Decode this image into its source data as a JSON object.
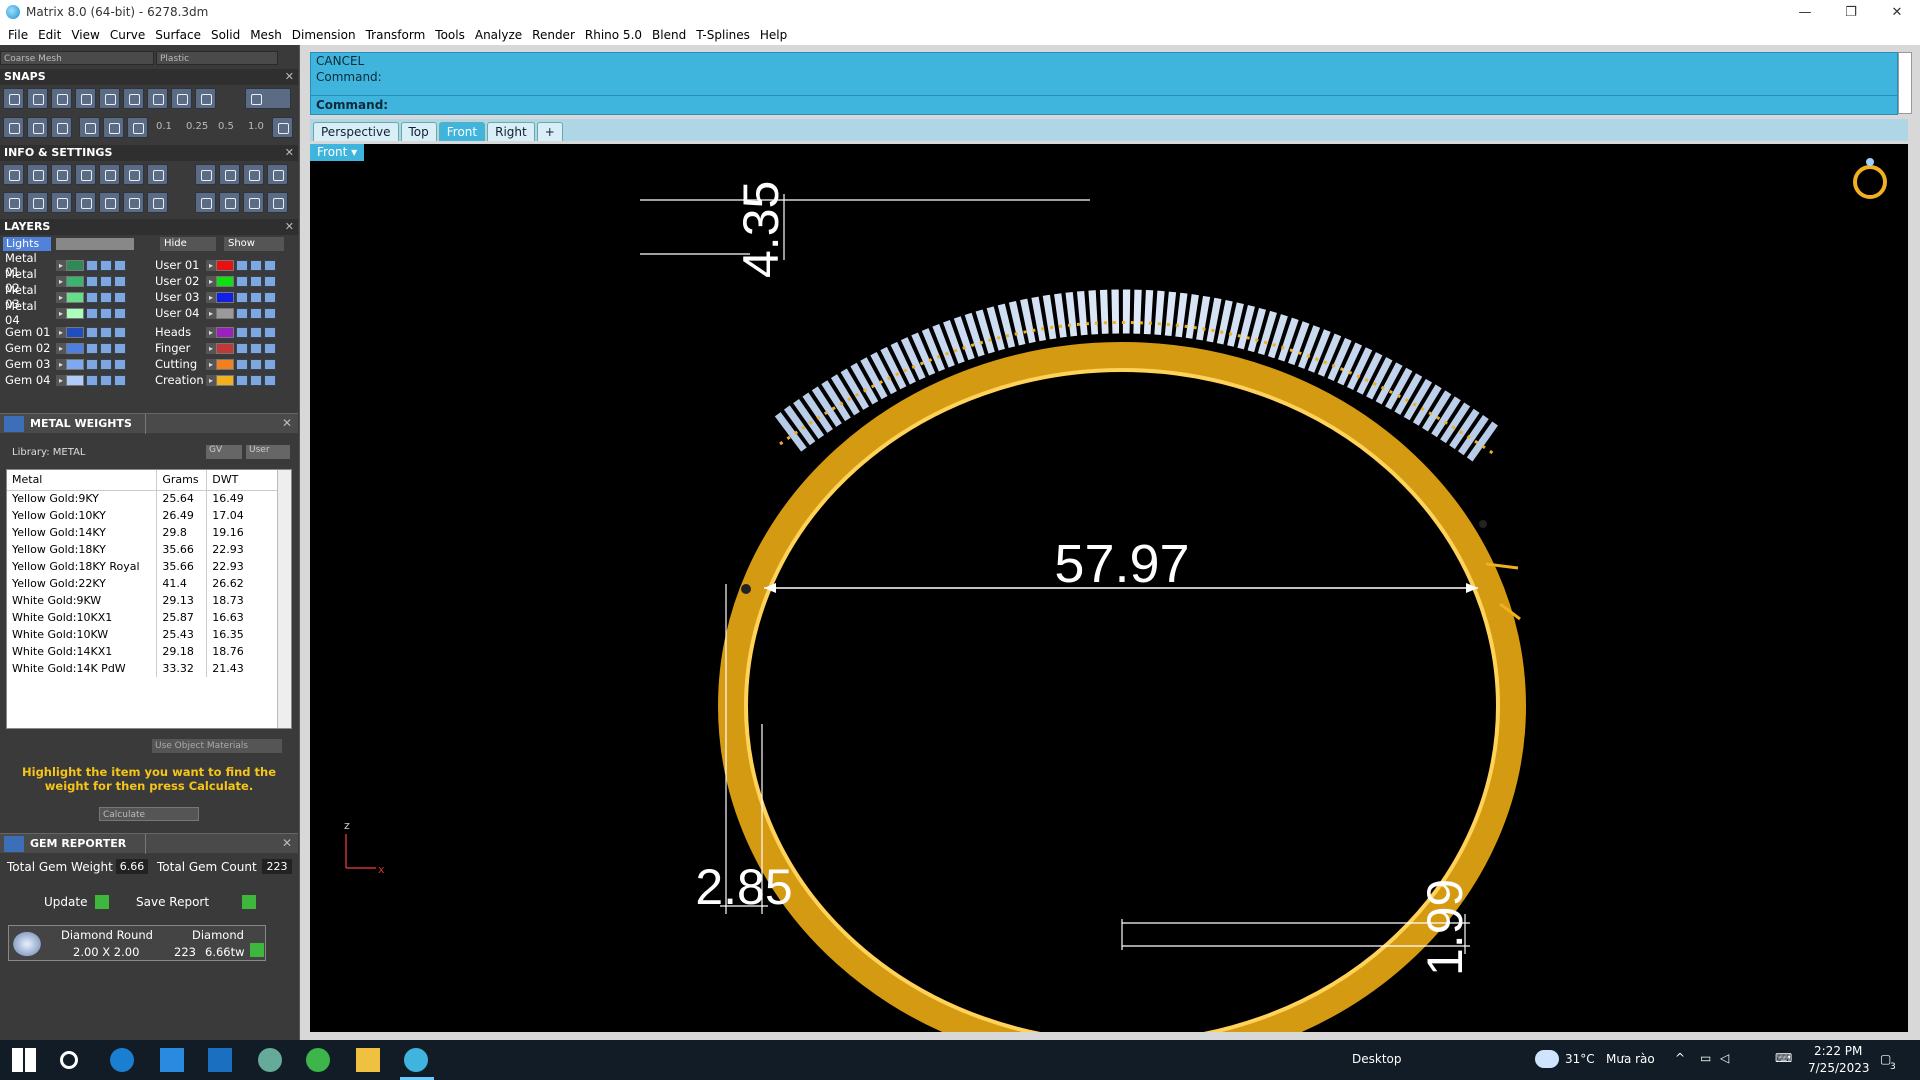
{
  "window": {
    "title": "Matrix 8.0 (64-bit) - 6278.3dm",
    "min": "—",
    "restore": "❐",
    "close": "✕"
  },
  "menu": [
    "File",
    "Edit",
    "View",
    "Curve",
    "Surface",
    "Solid",
    "Mesh",
    "Dimension",
    "Transform",
    "Tools",
    "Analyze",
    "Render",
    "Rhino 5.0",
    "Blend",
    "T-Splines",
    "Help"
  ],
  "top_combos": {
    "mesh": "Coarse Mesh",
    "material": "Plastic"
  },
  "snaps": {
    "title": "SNAPS",
    "values": [
      "0.1",
      "0.25",
      "0.5",
      "1.0"
    ]
  },
  "info": {
    "title": "INFO & SETTINGS"
  },
  "layers": {
    "title": "LAYERS",
    "lights": "Lights",
    "hide": "Hide",
    "show": "Show",
    "left": [
      {
        "name": "Metal 01",
        "color": "#2e8b57"
      },
      {
        "name": "Metal 02",
        "color": "#3cb371"
      },
      {
        "name": "Metal 03",
        "color": "#66dd88"
      },
      {
        "name": "Metal 04",
        "color": "#aaffbb"
      },
      {
        "name": "Gem 01",
        "color": "#1f4fbf"
      },
      {
        "name": "Gem 02",
        "color": "#4c7fe0"
      },
      {
        "name": "Gem 03",
        "color": "#7ea8f0"
      },
      {
        "name": "Gem 04",
        "color": "#b0ccf8"
      }
    ],
    "right": [
      {
        "name": "User 01",
        "color": "#e81010"
      },
      {
        "name": "User 02",
        "color": "#10e010"
      },
      {
        "name": "User 03",
        "color": "#1020e8"
      },
      {
        "name": "User 04",
        "color": "#9a9a9a"
      },
      {
        "name": "Heads",
        "color": "#9a20c0"
      },
      {
        "name": "Finger",
        "color": "#c03838"
      },
      {
        "name": "Cutting",
        "color": "#f08020"
      },
      {
        "name": "Creation",
        "color": "#f0b020"
      }
    ]
  },
  "metal_weights": {
    "title": "METAL WEIGHTS",
    "library": "Library: METAL",
    "gv": "GV",
    "user": "User",
    "columns": [
      "Metal",
      "Grams",
      "DWT"
    ],
    "rows": [
      [
        "Yellow Gold:9KY",
        "25.64",
        "16.49"
      ],
      [
        "Yellow Gold:10KY",
        "26.49",
        "17.04"
      ],
      [
        "Yellow Gold:14KY",
        "29.8",
        "19.16"
      ],
      [
        "Yellow Gold:18KY",
        "35.66",
        "22.93"
      ],
      [
        "Yellow Gold:18KY Royal",
        "35.66",
        "22.93"
      ],
      [
        "Yellow Gold:22KY",
        "41.4",
        "26.62"
      ],
      [
        "White Gold:9KW",
        "29.13",
        "18.73"
      ],
      [
        "White Gold:10KX1",
        "25.87",
        "16.63"
      ],
      [
        "White Gold:10KW",
        "25.43",
        "16.35"
      ],
      [
        "White Gold:14KX1",
        "29.18",
        "18.76"
      ],
      [
        "White Gold:14K PdW",
        "33.32",
        "21.43"
      ]
    ],
    "use_object_materials": "Use Object Materials",
    "hint": "Highlight the item you want to find the weight for then press Calculate.",
    "calculate": "Calculate"
  },
  "gem_reporter": {
    "title": "GEM REPORTER",
    "total_weight_label": "Total Gem Weight",
    "total_weight": "6.66",
    "total_count_label": "Total Gem Count",
    "total_count": "223",
    "update": "Update",
    "save_report": "Save Report",
    "gem": {
      "shape": "Diamond Round",
      "size": "2.00 X 2.00",
      "material": "Diamond",
      "count": "223",
      "weight": "6.66tw"
    }
  },
  "command": {
    "line1": "CANCEL",
    "line2": "Command:",
    "prompt": "Command:"
  },
  "viewport_tabs": [
    "Perspective",
    "Top",
    "Front",
    "Right",
    "+"
  ],
  "active_tab": "Front",
  "viewport_label": "Front",
  "dimensions": {
    "width": "57.97",
    "top_thickness": "4.35",
    "side_thickness": "2.85",
    "bottom_thickness": "1.99"
  },
  "axis": {
    "z": "z",
    "x": "x"
  },
  "taskbar": {
    "desktop": "Desktop",
    "weather": "31°C",
    "weather_text": "Mưa rào",
    "time": "2:22 PM",
    "date": "7/25/2023",
    "notif": "3"
  }
}
